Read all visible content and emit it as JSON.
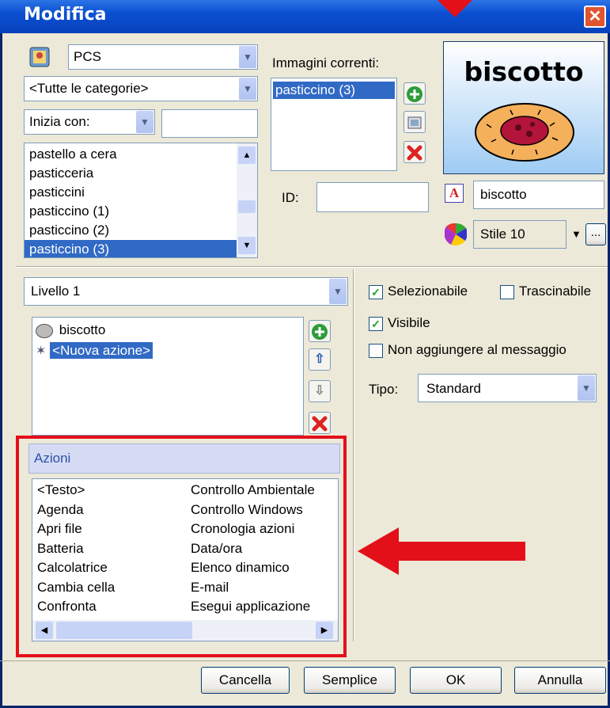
{
  "window": {
    "title": "Modifica",
    "close": "✕"
  },
  "library": {
    "symbol_set": "PCS",
    "category": "<Tutte le categorie>",
    "filter_mode": "Inizia con:",
    "filter_value": ""
  },
  "symbol_list": {
    "items": [
      "pastello a cera",
      "pasticceria",
      "pasticcini",
      "pasticcino (1)",
      "pasticcino (2)",
      "pasticcino (3)"
    ],
    "selected_index": 5
  },
  "current_images": {
    "label": "Immagini correnti:",
    "items": [
      "pasticcino (3)"
    ]
  },
  "id_field": {
    "label": "ID:",
    "value": ""
  },
  "preview": {
    "caption": "biscotto"
  },
  "label_field": {
    "value": "biscotto"
  },
  "style": {
    "value": "Stile 10",
    "more": "..."
  },
  "level": {
    "value": "Livello 1"
  },
  "actions_list": {
    "items": [
      "biscotto",
      "<Nuova azione>"
    ]
  },
  "options": {
    "selectable": "Selezionabile",
    "draggable": "Trascinabile",
    "visible": "Visibile",
    "no_message": "Non aggiungere al messaggio",
    "type_label": "Tipo:",
    "type_value": "Standard",
    "selectable_checked": true,
    "visible_checked": true
  },
  "actions_panel": {
    "header": "Azioni",
    "col1": [
      "<Testo>",
      "Agenda",
      "Apri file",
      "Batteria",
      "Calcolatrice",
      "Cambia cella",
      "Confronta"
    ],
    "col2": [
      "Controllo Ambientale",
      "Controllo Windows",
      "Cronologia azioni",
      "Data/ora",
      "Elenco dinamico",
      "E-mail",
      "Esegui applicazione"
    ]
  },
  "buttons": {
    "clear": "Cancella",
    "simple": "Semplice",
    "ok": "OK",
    "cancel": "Annulla"
  },
  "colors": {
    "highlight": "#e3101a",
    "selection": "#316ac5",
    "title": "#0a4fd1"
  }
}
